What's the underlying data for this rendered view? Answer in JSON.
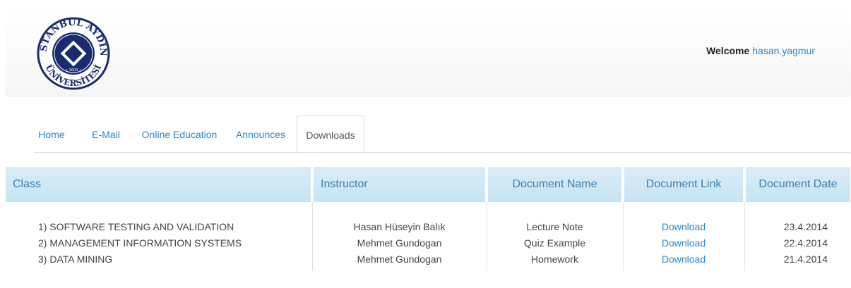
{
  "header": {
    "logo": {
      "top_text": "İSTANBUL AYDIN",
      "bottom_text": "ÜNİVERSİTESİ",
      "inner_text": "İSTANBUL AYDIN ÜNİVERSİTESİ",
      "year": "• 2003 •",
      "colors": {
        "navy": "#1a2a6c",
        "white": "#ffffff"
      }
    },
    "welcome_label": "Welcome",
    "username": "hasan.yagmur"
  },
  "nav": {
    "tabs": [
      {
        "label": "Home",
        "active": false
      },
      {
        "label": "E-Mail",
        "active": false
      },
      {
        "label": "Online Education",
        "active": false
      },
      {
        "label": "Announces",
        "active": false
      },
      {
        "label": "Downloads",
        "active": true
      }
    ]
  },
  "table": {
    "columns": [
      "Class",
      "Instructor",
      "Document Name",
      "Document Link",
      "Document Date"
    ],
    "rows": [
      {
        "class": "1) SOFTWARE TESTING AND VALIDATION",
        "instructor": "Hasan Hüseyin Balık",
        "document_name": "Lecture Note",
        "link": "Download",
        "date": "23.4.2014"
      },
      {
        "class": "2) MANAGEMENT INFORMATION SYSTEMS",
        "instructor": "Mehmet Gundogan",
        "document_name": "Quiz Example",
        "link": "Download",
        "date": "22.4.2014"
      },
      {
        "class": "3) DATA MINING",
        "instructor": "Mehmet Gundogan",
        "document_name": "Homework",
        "link": "Download",
        "date": "21.4.2014"
      }
    ]
  },
  "colors": {
    "link": "#2a86c9",
    "header_cell_bg": "#c7e3f3",
    "header_cell_text": "#3b7fae"
  }
}
